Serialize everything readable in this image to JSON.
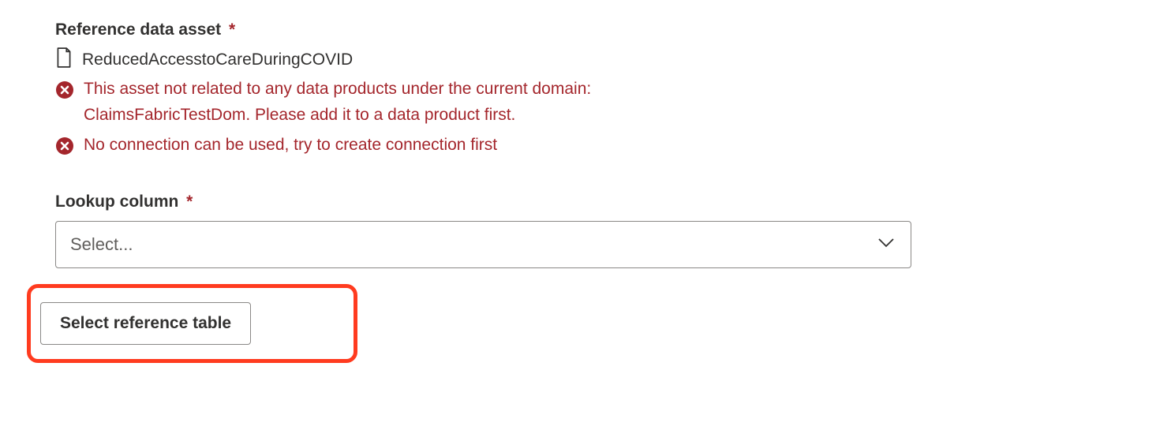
{
  "referenceDataAsset": {
    "label": "Reference data asset",
    "required_mark": "*",
    "asset_name": "ReducedAccesstoCareDuringCOVID"
  },
  "errors": {
    "not_related": "This asset not related to any data products under the current domain: ClaimsFabricTestDom. Please add it to a data product first.",
    "no_connection": "No connection can be used, try to create connection first"
  },
  "lookupColumn": {
    "label": "Lookup column",
    "required_mark": "*",
    "placeholder": "Select..."
  },
  "actions": {
    "select_reference_table": "Select reference table"
  }
}
